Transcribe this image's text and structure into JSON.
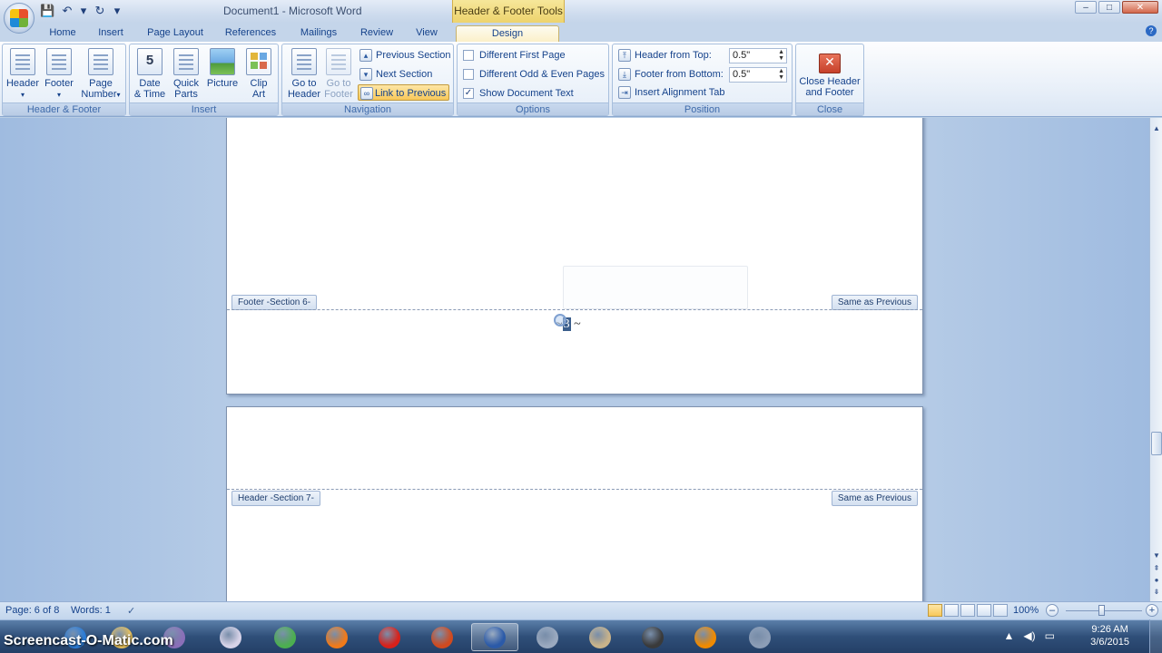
{
  "window": {
    "title": "Document1 - Microsoft Word",
    "tools_header": "Header & Footer Tools",
    "controls": {
      "minimize": "–",
      "maximize": "□",
      "close": "✕"
    }
  },
  "qat": {
    "save": "💾",
    "undo": "↶",
    "undo_dropdown": "▾",
    "redo": "↻",
    "customize": "▾"
  },
  "tabs": [
    "Home",
    "Insert",
    "Page Layout",
    "References",
    "Mailings",
    "Review",
    "View",
    "Design"
  ],
  "active_tab": "Design",
  "ribbon": {
    "header_footer": {
      "label": "Header & Footer",
      "header": "Header",
      "footer": "Footer",
      "page_number_1": "Page",
      "page_number_2": "Number",
      "arrow": "▾"
    },
    "insert": {
      "label": "Insert",
      "date_time_1": "Date",
      "date_time_2": "& Time",
      "quick_parts_1": "Quick",
      "quick_parts_2": "Parts",
      "picture": "Picture",
      "clip_art_1": "Clip",
      "clip_art_2": "Art"
    },
    "navigation": {
      "label": "Navigation",
      "goto_header_1": "Go to",
      "goto_header_2": "Header",
      "goto_footer_1": "Go to",
      "goto_footer_2": "Footer",
      "previous_section": "Previous Section",
      "next_section": "Next Section",
      "link_to_previous": "Link to Previous"
    },
    "options": {
      "label": "Options",
      "different_first_page": "Different First Page",
      "different_first_page_checked": false,
      "different_odd_even": "Different Odd & Even Pages",
      "different_odd_even_checked": false,
      "show_document_text": "Show Document Text",
      "show_document_text_checked": true,
      "checkmark": "✓"
    },
    "position": {
      "label": "Position",
      "header_from_top": "Header from Top:",
      "header_from_top_value": "0.5\"",
      "footer_from_bottom": "Footer from Bottom:",
      "footer_from_bottom_value": "0.5\"",
      "insert_alignment_tab": "Insert Alignment Tab",
      "spin_arrows": "▲▼"
    },
    "close": {
      "label": "Close",
      "close_hf_1": "Close Header",
      "close_hf_2": "and Footer"
    }
  },
  "document": {
    "footer_tag": "Footer -Section 6-",
    "footer_same_as_previous": "Same as Previous",
    "page_number_left": "~",
    "page_number_value": "3",
    "page_number_right": "~",
    "header_tag": "Header -Section 7-",
    "header_same_as_previous": "Same as Previous"
  },
  "scrollbar": {
    "up": "▲",
    "down": "▼",
    "prev_page": "⇞",
    "browse": "●",
    "next_page": "⇟"
  },
  "status": {
    "page": "Page: 6 of 8",
    "words": "Words: 1",
    "zoom": "100%",
    "zoom_minus": "–",
    "zoom_plus": "+",
    "proof_icon": "✓"
  },
  "taskbar": {
    "watermark": "Screencast-O-Matic.com",
    "time": "9:26 AM",
    "date": "3/6/2015",
    "tray_icons": [
      "▲",
      "◀)",
      "▭"
    ],
    "apps": [
      {
        "name": "ie",
        "color": "#2a7bd6"
      },
      {
        "name": "explorer",
        "color": "#e7c05a"
      },
      {
        "name": "media",
        "color": "#8a6fb8"
      },
      {
        "name": "stickies",
        "color": "#d7d3e8"
      },
      {
        "name": "chrome",
        "color": "#4caf50"
      },
      {
        "name": "firefox",
        "color": "#f07a1a"
      },
      {
        "name": "opera",
        "color": "#d8211a"
      },
      {
        "name": "powerpoint",
        "color": "#d04a1f"
      },
      {
        "name": "word",
        "color": "#2b5aa8"
      },
      {
        "name": "paint-brush",
        "color": "#9aa9bf"
      },
      {
        "name": "paint",
        "color": "#c9b38a"
      },
      {
        "name": "network",
        "color": "#3a3a3a"
      },
      {
        "name": "vlc",
        "color": "#f08a00"
      },
      {
        "name": "snipping",
        "color": "#8c9db6"
      }
    ]
  }
}
